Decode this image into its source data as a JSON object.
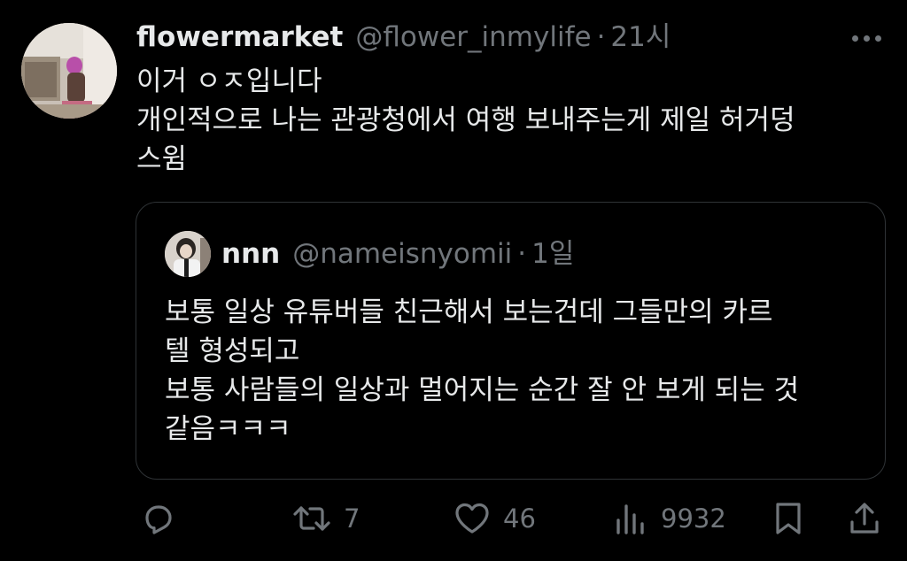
{
  "tweet": {
    "author": {
      "display_name": "flowermarket",
      "handle": "@flower_inmylife"
    },
    "separator": "·",
    "time": "21시",
    "lines": [
      "이거 ㅇㅈ입니다",
      "개인적으로 나는 관광청에서 여행 보내주는게 제일 허거덩",
      "스윔"
    ]
  },
  "quoted_tweet": {
    "author": {
      "display_name": "nnn",
      "handle": "@nameisnyomii"
    },
    "separator": "·",
    "time": "1일",
    "lines": [
      "보통 일상 유튜버들 친근해서 보는건데 그들만의 카르",
      "텔 형성되고",
      "보통 사람들의 일상과 멀어지는 순간 잘 안 보게 되는 것",
      "같음ㅋㅋㅋ"
    ]
  },
  "actions": {
    "reply": {
      "icon": "reply-icon"
    },
    "retweet": {
      "icon": "retweet-icon",
      "count": "7"
    },
    "like": {
      "icon": "heart-icon",
      "count": "46"
    },
    "views": {
      "icon": "views-icon",
      "count": "9932"
    },
    "bookmark": {
      "icon": "bookmark-icon"
    },
    "share": {
      "icon": "share-icon"
    }
  },
  "colors": {
    "background": "#000000",
    "primary_text": "#e7e9ea",
    "secondary_text": "#71767b",
    "border": "#2f3336"
  }
}
